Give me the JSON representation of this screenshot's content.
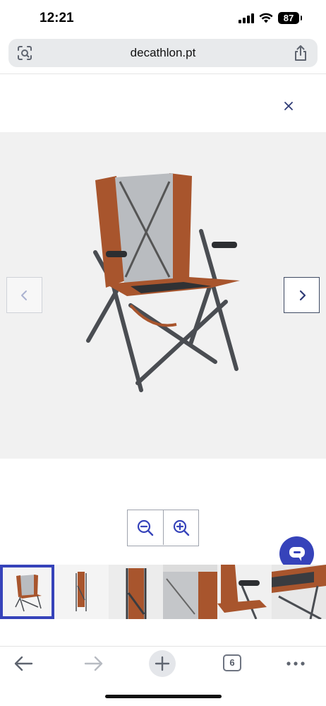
{
  "status_bar": {
    "time": "12:21",
    "battery": "87",
    "icons": [
      "signal-icon",
      "wifi-icon",
      "battery-icon"
    ]
  },
  "browser": {
    "url": "decathlon.pt",
    "left_icon": "page-settings-icon",
    "right_icon": "share-icon"
  },
  "gallery": {
    "close_icon": "close-icon",
    "prev_icon": "chevron-left-icon",
    "next_icon": "chevron-right-icon",
    "zoom_out_icon": "zoom-out-icon",
    "zoom_in_icon": "zoom-in-icon",
    "thumbnails": [
      {
        "name": "chair-front-view",
        "selected": true
      },
      {
        "name": "chair-folded-view",
        "selected": false
      },
      {
        "name": "chair-folded-closeup",
        "selected": false
      },
      {
        "name": "chair-mesh-closeup",
        "selected": false
      },
      {
        "name": "chair-armrest-closeup",
        "selected": false
      },
      {
        "name": "chair-side-closeup",
        "selected": false
      }
    ]
  },
  "chat": {
    "icon": "chat-icon"
  },
  "toolbar": {
    "back_icon": "back-arrow-icon",
    "forward_icon": "forward-arrow-icon",
    "new_tab_icon": "plus-icon",
    "tab_count": "6",
    "more_icon": "more-icon"
  },
  "colors": {
    "brand_blue": "#3643ba",
    "chair_leather": "#a8552d",
    "frame_grey": "#4a4d52"
  }
}
